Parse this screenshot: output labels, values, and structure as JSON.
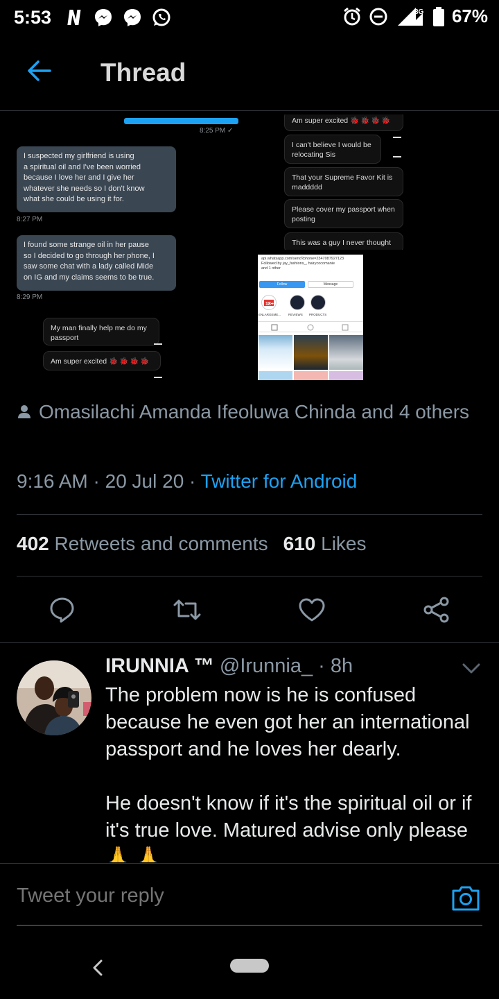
{
  "status_bar": {
    "time": "5:53",
    "battery": "67%",
    "network": "3G"
  },
  "header": {
    "title": "Thread",
    "back_icon": "arrow-left-icon"
  },
  "tweet_media": {
    "chat_left": {
      "sent_time": "8:25 PM ✓",
      "bubble1": "I suspected my girlfriend is using\na spiritual oil and I've been worried\nbecause I love her and I give her\nwhatever she needs so I don't know\nwhat she could be using it for.",
      "time1": "8:27 PM",
      "bubble2": "I found some strange oil in her pause\nso I decided to go through her phone, I\nsaw some chat with a lady called Mide\non IG and my claims seems to be true.",
      "time2": "8:29 PM",
      "bubble3": "My man finally help me do my\npassport",
      "bubble4": "Am super excited",
      "emoji": "🐞🐞🐞🐞"
    },
    "chat_right": {
      "b1": "Am super excited",
      "b2": "I can't believe I would be\nrelocating Sis",
      "b3": "That your Supreme Favor Kit is\nmaddddd",
      "b4": "Please cover my passport when\nposting",
      "b5": "This was a guy I never thought"
    },
    "instagram": {
      "info": "api.whatsapp.com/send?phone=2347087927123\nFollowed by jay_fashions_, hairycocomanie\nand 1 other",
      "follow": "Follow",
      "message": "Message",
      "highlights": [
        "ENLARGEME...",
        "REVIEWS",
        "PRODUCTS"
      ]
    }
  },
  "tweet_meta": {
    "liked_by": "Omasilachi Amanda Ifeoluwa Chinda and 4 others",
    "time": "9:16 AM",
    "date": "20 Jul 20",
    "source": "Twitter for Android",
    "retweets_count": "402",
    "retweets_label": "Retweets and comments",
    "likes_count": "610",
    "likes_label": "Likes"
  },
  "actions": [
    "reply-icon",
    "retweet-icon",
    "like-icon",
    "share-icon"
  ],
  "reply": {
    "name": "IRUNNIA ™",
    "handle": "@Irunnia_ · 8h",
    "text": "The problem now is he is confused because he even got her an international passport and he loves her dearly.\n\nHe doesn't know if it's the spiritual oil  or if it's true love. Matured advise only please 🙏 🙏"
  },
  "compose": {
    "placeholder": "Tweet your reply"
  },
  "colors": {
    "accent": "#1da1f2",
    "muted": "#8b98a5",
    "background": "#000000"
  }
}
